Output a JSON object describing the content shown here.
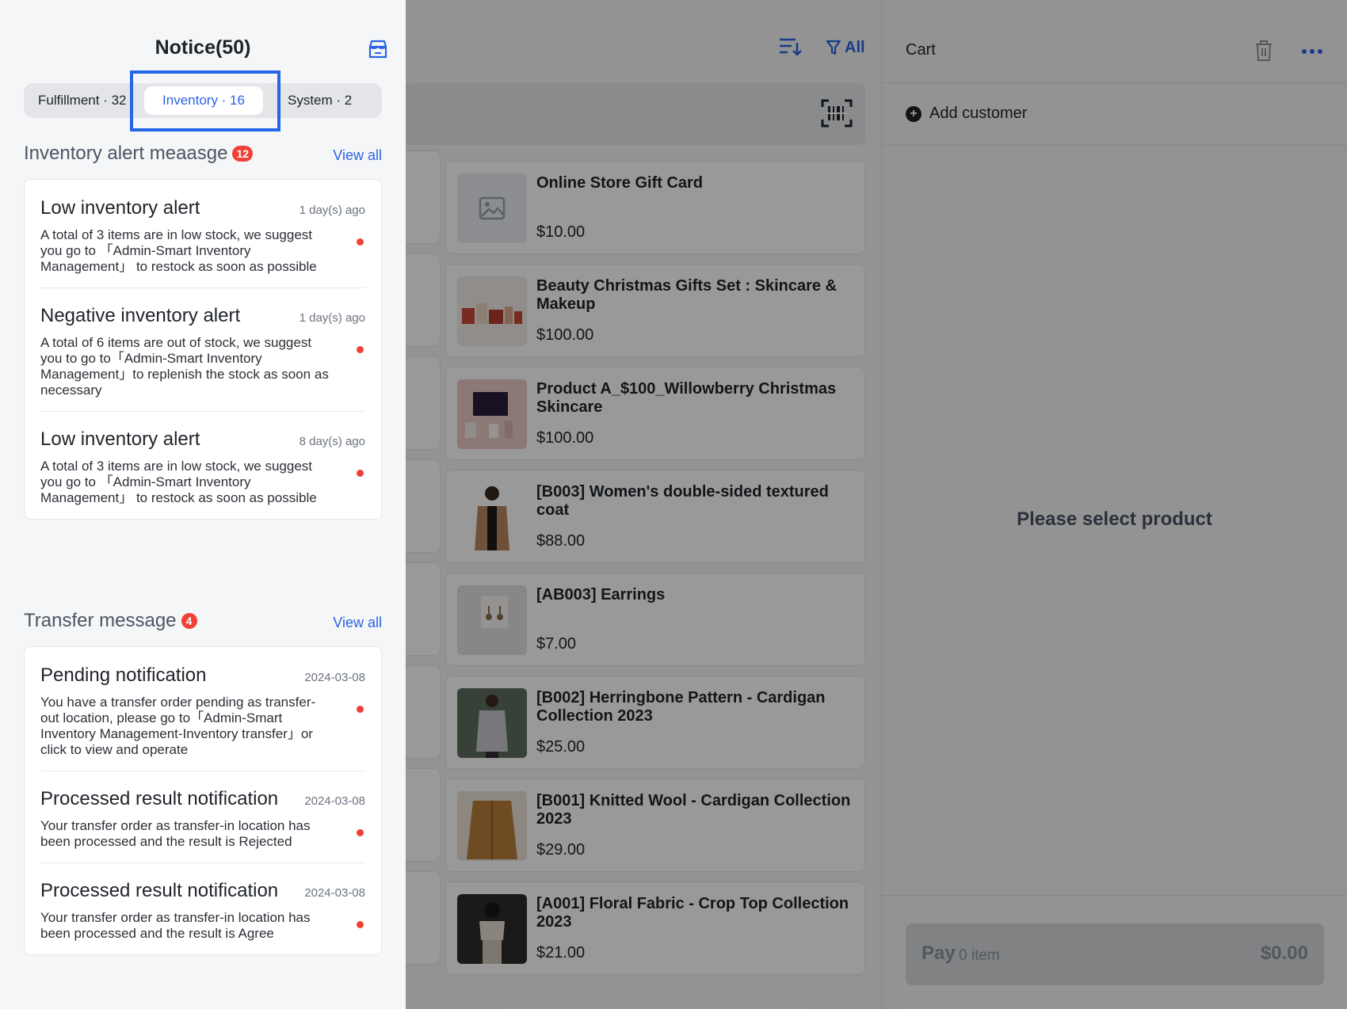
{
  "notice": {
    "title": "Notice(50)",
    "tabs": [
      {
        "label": "Fulfillment · 32"
      },
      {
        "label": "Inventory · 16"
      },
      {
        "label": "System · 2"
      }
    ],
    "inventory_section": {
      "title": "Inventory alert meaasge",
      "badge": "12",
      "view_all": "View all",
      "items": [
        {
          "title": "Low inventory alert",
          "time": "1 day(s) ago",
          "body": "A total of 3 items are in low stock, we suggest you go to 「Admin-Smart Inventory Management」 to restock as soon as possible"
        },
        {
          "title": "Negative inventory alert",
          "time": "1 day(s) ago",
          "body": "A total of 6 items are out of stock, we suggest you to go to「Admin-Smart Inventory Management」to replenish the stock as soon as necessary"
        },
        {
          "title": "Low inventory alert",
          "time": "8 day(s) ago",
          "body": "A total of 3 items are in low stock, we suggest you go to 「Admin-Smart Inventory Management」 to restock as soon as possible"
        }
      ]
    },
    "transfer_section": {
      "title": "Transfer message",
      "badge": "4",
      "view_all": "View all",
      "items": [
        {
          "title": "Pending notification",
          "time": "2024-03-08",
          "body": "You have a transfer order pending as transfer-out location, please go to「Admin-Smart Inventory Management-Inventory transfer」or click to view and operate"
        },
        {
          "title": "Processed result notification",
          "time": "2024-03-08",
          "body": "Your transfer order as transfer-in location has been processed and the result is Rejected"
        },
        {
          "title": "Processed result notification",
          "time": "2024-03-08",
          "body": "Your transfer order as transfer-in location has been processed and the result is Agree"
        }
      ]
    }
  },
  "products": {
    "filter_label": "All",
    "items": [
      {
        "name": "Online Store Gift Card",
        "price": "$10.00"
      },
      {
        "name": "Beauty Christmas Gifts Set : Skincare & Makeup",
        "price": "$100.00"
      },
      {
        "name": "Product A_$100_Willowberry Christmas Skincare",
        "price": "$100.00"
      },
      {
        "name": "[B003] Women's double-sided textured coat",
        "price": "$88.00"
      },
      {
        "name": "[AB003] Earrings",
        "price": "$7.00"
      },
      {
        "name": "[B002] Herringbone Pattern - Cardigan Collection 2023",
        "price": "$25.00"
      },
      {
        "name": "[B001] Knitted Wool - Cardigan Collection 2023",
        "price": "$29.00"
      },
      {
        "name": "[A001] Floral Fabric - Crop Top Collection 2023",
        "price": "$21.00"
      }
    ]
  },
  "cart": {
    "title": "Cart",
    "add_customer": "Add customer",
    "empty_message": "Please select product",
    "pay_label": "Pay",
    "pay_items": "0 item",
    "pay_amount": "$0.00"
  },
  "colors": {
    "accent": "#2a63e6",
    "badge": "#ef4135",
    "highlight_box": "#2566e8"
  }
}
